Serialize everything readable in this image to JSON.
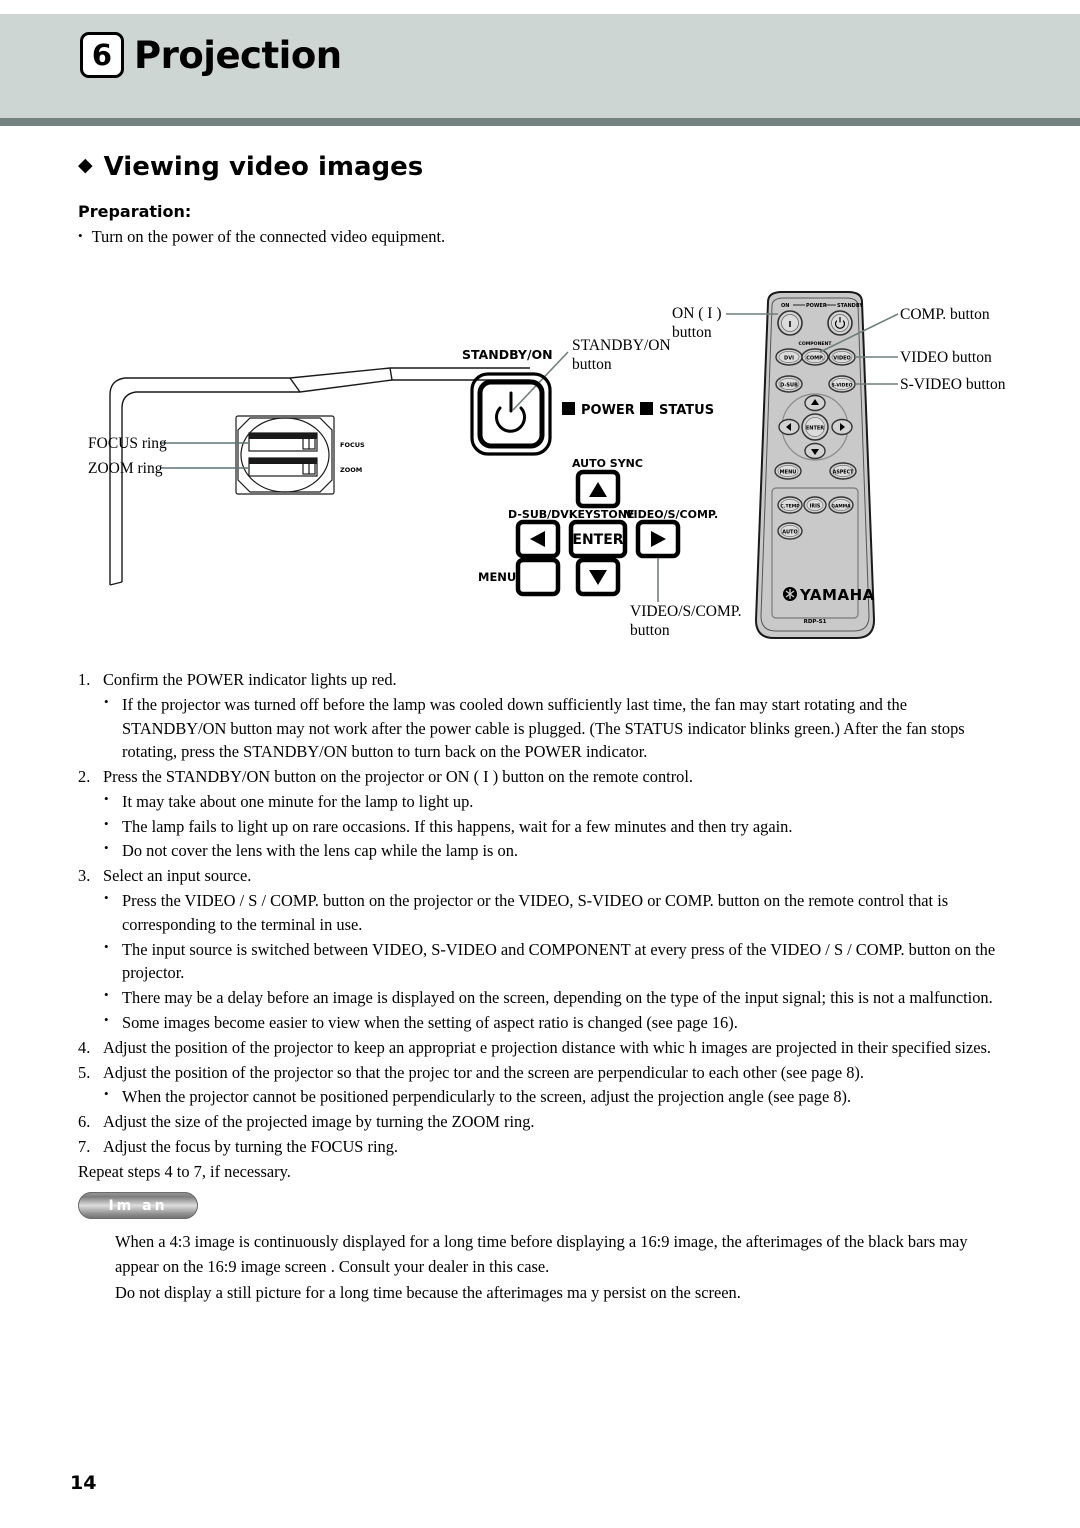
{
  "header": {
    "chapter_number": "6",
    "chapter_title": "Projection"
  },
  "section": {
    "bullet_glyph": "◆",
    "title": "Viewing video images",
    "preparation_heading": "Preparation:",
    "preparation_bullet": "Turn on the power of the connected video equipment."
  },
  "figure": {
    "projector_labels": {
      "focus_ring": "FOCUS ring",
      "zoom_ring": "ZOOM ring",
      "lens_focus": "FOCUS",
      "lens_zoom": "ZOOM"
    },
    "control_panel": {
      "standby_on_label": "STANDBY/ON",
      "standby_on_callout_line1": "STANDBY/ON",
      "standby_on_callout_line2": "button",
      "power_indicator": "POWER",
      "status_indicator": "STATUS",
      "auto_sync": "AUTO SYNC",
      "d_sub_dvi": "D-SUB/DVI",
      "keystone": "KEYSTONE",
      "enter": "ENTER",
      "video_s_comp": "VIDEO/S/COMP.",
      "menu": "MENU",
      "video_callout_line1": "VIDEO/S/COMP.",
      "video_callout_line2": "button"
    },
    "remote": {
      "top_row_on": "ON",
      "top_row_power": "POWER",
      "top_row_standby": "STANDBY",
      "component": "COMPONENT",
      "btn_on": "I",
      "btn_standby": "⏻",
      "btn_dvi": "DVI",
      "btn_comp": "COMP.",
      "btn_video": "VIDEO",
      "btn_dsub": "D-SUB",
      "btn_svideo": "S-VIDEO",
      "btn_enter": "ENTER",
      "btn_menu": "MENU",
      "btn_aspect": "ASPECT",
      "btn_ctemp": "C.TEMP",
      "btn_iris": "IRIS",
      "btn_gamma": "GAMMA",
      "btn_auto": "AUTO",
      "brand": "YAMAHA",
      "model": "RDP-S1"
    },
    "callouts": {
      "on_button_line1": "ON ( I )",
      "on_button_line2": "button",
      "comp_button": "COMP. button",
      "video_button": "VIDEO button",
      "svideo_button": "S-VIDEO button"
    }
  },
  "steps": [
    {
      "number": "1.",
      "text": "Confirm the POWER indicator lights up red.",
      "subs": [
        "If the projector was turned off before the lamp was cooled down sufficiently last time, the fan may start rotating and the STANDBY/ON button may not work after the power cable is plugged. (The STATUS indicator blinks green.) After the fan stops rotating, press the STANDBY/ON button to turn back on the POWER indicator."
      ]
    },
    {
      "number": "2.",
      "text": "Press the STANDBY/ON button on the projector or ON ( I ) button on the remote control.",
      "subs": [
        "It may take about one minute for the lamp to light up.",
        "The lamp fails to light up on rare occasions. If this happens, wait for a few minutes and then try again.",
        "Do not cover the lens with the lens cap while the lamp is on."
      ]
    },
    {
      "number": "3.",
      "text": "Select an input source.",
      "subs": [
        "Press the VIDEO / S / COMP. button on the projector or the VIDEO, S-VIDEO or COMP. button on the remote control that is corresponding to the terminal in use.",
        "The input source is switched between VIDEO, S-VIDEO and COMPONENT at every press of the VIDEO / S / COMP. button on the projector.",
        "There may be a delay before an image is displayed on the screen, depending on the type of the input signal; this is not a malfunction.",
        "Some images become easier to view when the setting of aspect ratio is changed (see page 16)."
      ]
    },
    {
      "number": "4.",
      "text": "Adjust the position of the projector to keep an appropriat      e projection distance with whic   h images are projected in their specified sizes.",
      "subs": []
    },
    {
      "number": "5.",
      "text": "Adjust the position of the projector so that the projec      tor and the screen are perpendicular to each other (see page 8).",
      "subs": [
        "When the projector cannot be positioned perpendicularly to the screen, adjust the projection angle (see page 8)."
      ]
    },
    {
      "number": "6.",
      "text": "Adjust the size of the projected image by turning the ZOOM ring.",
      "subs": []
    },
    {
      "number": "7.",
      "text": "Adjust the focus by turning the FOCUS ring.",
      "subs": []
    }
  ],
  "repeat_line": "Repeat steps 4 to 7, if necessary.",
  "note": {
    "badge_label": "Im    an",
    "lines": [
      "When a 4:3 image is continuously displayed for a long time before displaying a 16:9 image, the afterimages of the black bars may appear on the 16:9 image screen      . Consult your dealer in this case.",
      "Do not display a still picture for a long time      because the afterimages ma      y persist on the screen."
    ]
  },
  "footer": {
    "page_number": "14"
  }
}
